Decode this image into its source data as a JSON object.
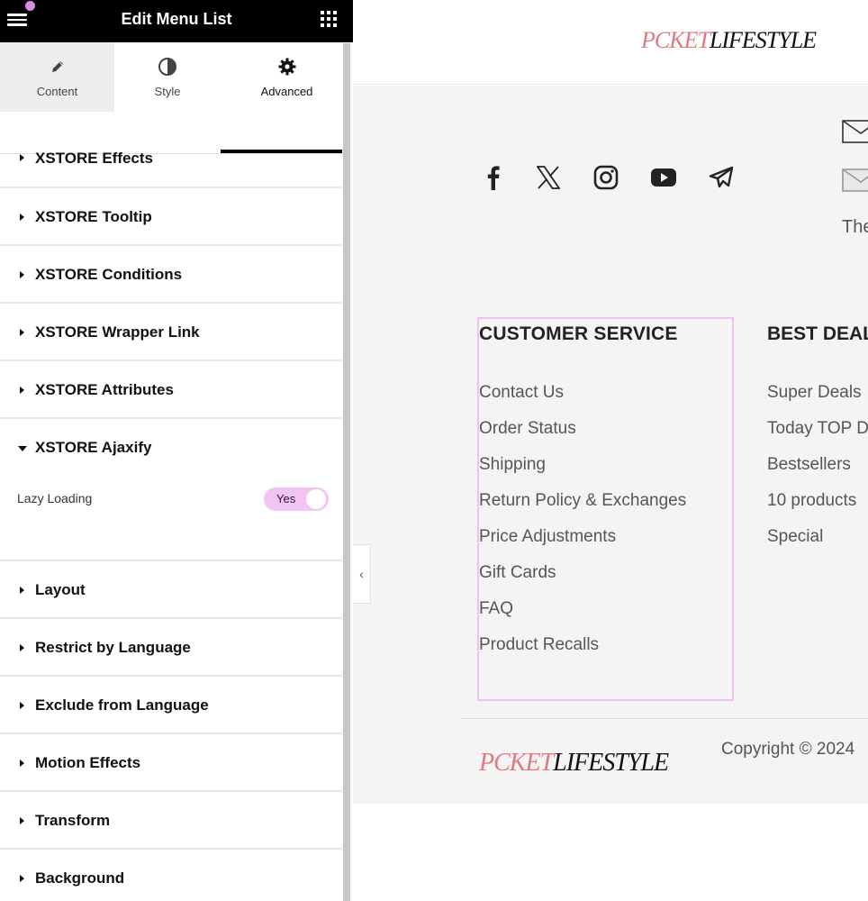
{
  "panel": {
    "title": "Edit Menu List",
    "tabs": [
      {
        "label": "Content",
        "icon": "pencil-icon"
      },
      {
        "label": "Style",
        "icon": "half-circle-icon"
      },
      {
        "label": "Advanced",
        "icon": "gear-icon"
      }
    ],
    "active_tab": "Advanced",
    "sections": [
      {
        "label": "XSTORE Effects"
      },
      {
        "label": "XSTORE Tooltip"
      },
      {
        "label": "XSTORE Conditions"
      },
      {
        "label": "XSTORE Wrapper Link"
      },
      {
        "label": "XSTORE Attributes"
      },
      {
        "label": "XSTORE Ajaxify",
        "expanded": true
      },
      {
        "label": "Layout"
      },
      {
        "label": "Restrict by Language"
      },
      {
        "label": "Exclude from Language"
      },
      {
        "label": "Motion Effects"
      },
      {
        "label": "Transform"
      },
      {
        "label": "Background"
      }
    ],
    "lazy_loading": {
      "label": "Lazy Loading",
      "toggle_text": "Yes",
      "enabled": true
    }
  },
  "preview": {
    "logo": {
      "part1": "PCKET",
      "part2": "LIFESTYLE"
    },
    "socials": [
      "facebook-icon",
      "x-twitter-icon",
      "instagram-icon",
      "youtube-icon",
      "telegram-icon"
    ],
    "contact_text": "The",
    "customer_service": {
      "title": "CUSTOMER SERVICE",
      "links": [
        "Contact Us",
        "Order Status",
        "Shipping",
        "Return Policy & Exchanges",
        "Price Adjustments",
        "Gift Cards",
        "FAQ",
        "Product Recalls"
      ]
    },
    "best_deals": {
      "title": "BEST DEAL",
      "links": [
        "Super Deals",
        "Today TOP D",
        "Bestsellers",
        "10 products",
        "Special"
      ]
    },
    "copyright": "Copyright © 2024"
  },
  "colors": {
    "accent_pink": "#e07a80",
    "toggle_bg": "#f1c4f4",
    "selection_border": "#efc2f2",
    "header_bg": "#000000"
  }
}
